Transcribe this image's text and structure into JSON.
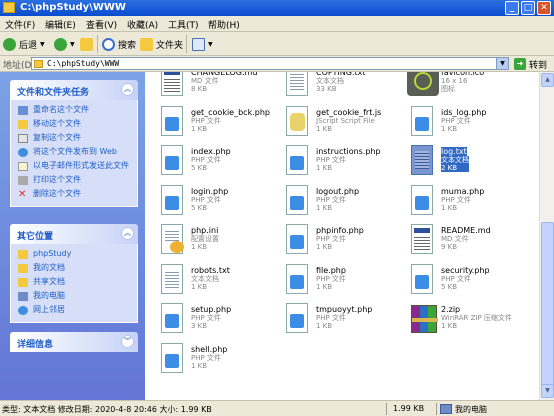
{
  "window": {
    "title": "C:\\phpStudy\\WWW"
  },
  "menu": [
    "文件(F)",
    "编辑(E)",
    "查看(V)",
    "收藏(A)",
    "工具(T)",
    "帮助(H)"
  ],
  "toolbar": {
    "back": "后退",
    "search": "搜索",
    "folders": "文件夹"
  },
  "address": {
    "label": "地址(D)",
    "value": "C:\\phpStudy\\WWW",
    "go": "转到"
  },
  "sidebar": {
    "tasks": {
      "title": "文件和文件夹任务",
      "items": [
        "重命名这个文件",
        "移动这个文件",
        "复制这个文件",
        "将这个文件发布到 Web",
        "以电子邮件形式发送此文件",
        "打印这个文件",
        "删除这个文件"
      ]
    },
    "places": {
      "title": "其它位置",
      "items": [
        "phpStudy",
        "我的文档",
        "共享文档",
        "我的电脑",
        "网上邻居"
      ]
    },
    "details": {
      "title": "详细信息"
    }
  },
  "files": [
    {
      "name": "CHANGELOG.md",
      "type": "MD 文件",
      "size": "8 KB",
      "icon": "doc-lines"
    },
    {
      "name": "COPYING.txt",
      "type": "文本文档",
      "size": "33 KB",
      "icon": "text"
    },
    {
      "name": "favicon.ico",
      "type": "16 x 16",
      "size": "图标",
      "icon": "ico"
    },
    {
      "name": "get_cookie_bck.php",
      "type": "PHP 文件",
      "size": "1 KB",
      "icon": "php"
    },
    {
      "name": "get_cookie_frt.js",
      "type": "JScript Script File",
      "size": "1 KB",
      "icon": "js"
    },
    {
      "name": "ids_log.php",
      "type": "PHP 文件",
      "size": "1 KB",
      "icon": "php"
    },
    {
      "name": "index.php",
      "type": "PHP 文件",
      "size": "5 KB",
      "icon": "php"
    },
    {
      "name": "instructions.php",
      "type": "PHP 文件",
      "size": "1 KB",
      "icon": "php"
    },
    {
      "name": "log.txt",
      "type": "文本文档",
      "size": "2 KB",
      "icon": "text-sel",
      "selected": true
    },
    {
      "name": "login.php",
      "type": "PHP 文件",
      "size": "5 KB",
      "icon": "php"
    },
    {
      "name": "logout.php",
      "type": "PHP 文件",
      "size": "1 KB",
      "icon": "php"
    },
    {
      "name": "muma.php",
      "type": "PHP 文件",
      "size": "1 KB",
      "icon": "php"
    },
    {
      "name": "php.ini",
      "type": "配置设置",
      "size": "1 KB",
      "icon": "ini"
    },
    {
      "name": "phpinfo.php",
      "type": "PHP 文件",
      "size": "1 KB",
      "icon": "php"
    },
    {
      "name": "README.md",
      "type": "MD 文件",
      "size": "9 KB",
      "icon": "doc-lines"
    },
    {
      "name": "robots.txt",
      "type": "文本文档",
      "size": "1 KB",
      "icon": "text"
    },
    {
      "name": "file.php",
      "type": "PHP 文件",
      "size": "1 KB",
      "icon": "php"
    },
    {
      "name": "security.php",
      "type": "PHP 文件",
      "size": "5 KB",
      "icon": "php"
    },
    {
      "name": "setup.php",
      "type": "PHP 文件",
      "size": "3 KB",
      "icon": "php"
    },
    {
      "name": "tmpuoyyt.php",
      "type": "PHP 文件",
      "size": "1 KB",
      "icon": "php"
    },
    {
      "name": "2.zip",
      "type": "WinRAR ZIP 压缩文件",
      "size": "1 KB",
      "icon": "rar"
    },
    {
      "name": "shell.php",
      "type": "PHP 文件",
      "size": "1 KB",
      "icon": "php"
    }
  ],
  "status": {
    "info": "类型: 文本文档 修改日期: 2020-4-8 20:46 大小: 1.99 KB",
    "size": "1.99 KB",
    "location": "我的电脑"
  }
}
